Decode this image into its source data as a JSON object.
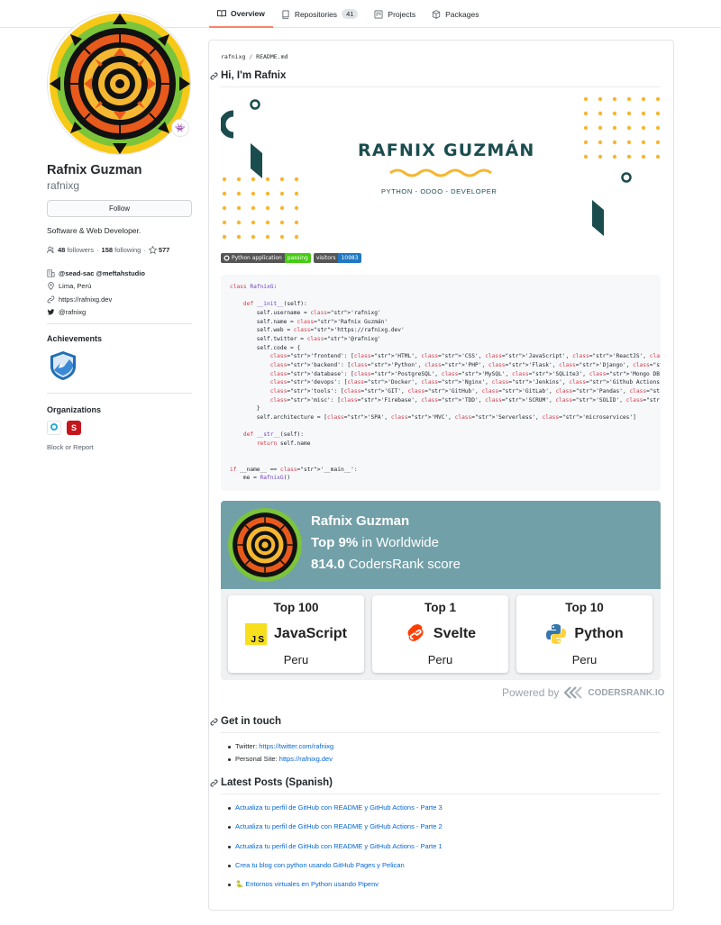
{
  "nav": {
    "tabs": [
      {
        "label": "Overview"
      },
      {
        "label": "Repositories",
        "count": "41"
      },
      {
        "label": "Projects"
      },
      {
        "label": "Packages"
      }
    ]
  },
  "profile": {
    "full_name": "Rafnix Guzman",
    "login": "rafnixg",
    "follow_label": "Follow",
    "bio": "Software & Web Developer.",
    "followers_count": "48",
    "followers_label": "followers",
    "following_count": "158",
    "following_label": "following",
    "stars_count": "577",
    "company": "@sead-sac @meftahstudio",
    "location": "Lima, Perú",
    "website": "https://rafnixg.dev",
    "twitter": "@rafnixg",
    "status_emoji": "👾",
    "achievements_title": "Achievements",
    "organizations_title": "Organizations",
    "orgs": [
      {
        "letter": "T-Gen"
      },
      {
        "letter": "S"
      }
    ],
    "block_label": "Block or Report"
  },
  "readme": {
    "crumb_user": "rafnixg",
    "crumb_file": "README.md",
    "heading": "Hi, I'm Rafnix",
    "banner_name": "RAFNIX GUZMÁN",
    "banner_sub": "PYTHON - ODOO - DEVELOPER",
    "shield1_left": "Python application",
    "shield1_right": "passing",
    "shield2_left": "visitors",
    "shield2_right": "10983",
    "code_lines": [
      "class RafnixG:",
      "",
      "    def __init__(self):",
      "        self.username = 'rafnixg'",
      "        self.name = 'Rafnix Guzmán'",
      "        self.web = 'https://rafnixg.dev'",
      "        self.twitter = '@rafnixg'",
      "        self.code = {",
      "            'frontend': ['HTML', 'CSS', 'JavaScript', 'ReactJS', 'Svelte', 'Boostrap', 'TailWind'],",
      "            'backend': ['Python', 'PHP', 'Flask', 'Django', 'Laravel', 'NodeJS', 'Odoo'],",
      "            'database': ['PostgreSQL', 'MySQL', 'SQLite3', 'Mongo DB'],",
      "            'devops': ['Docker', 'Nginx', 'Jenkins', 'Github Actions', 'AWS', 'Heroku'],",
      "            'tools': ['GIT', 'GitHub', 'GitLab', 'Pandas', 'Jupyter notebook', 'SQLAlchemy', 'Redis', 'Celery'],",
      "            'misc': ['Firebase', 'TDD', 'SCRUM', 'SOLID', 'GNU/Linux']",
      "        }",
      "        self.architecture = ['SPA', 'MVC', 'Serverless', 'microservices']",
      "",
      "    def __str__(self):",
      "        return self.name",
      "",
      "",
      "if __name__ == '__main__':",
      "    me = RafnixG()"
    ],
    "coders": {
      "name": "Rafnix Guzman",
      "rank_bold": "Top 9%",
      "rank_rest": " in Worldwide",
      "score_bold": "814.0",
      "score_rest": " CodersRank score",
      "tiles": [
        {
          "top": "Top 100",
          "lang": "JavaScript",
          "place": "Peru",
          "icon": "javascript-icon"
        },
        {
          "top": "Top 1",
          "lang": "Svelte",
          "place": "Peru",
          "icon": "svelte-icon"
        },
        {
          "top": "Top 10",
          "lang": "Python",
          "place": "Peru",
          "icon": "python-icon"
        }
      ],
      "powered_by": "Powered by",
      "powered_logo": "CODERSRANK.IO"
    },
    "contact_heading": "Get in touch",
    "contact": [
      {
        "label": "Twitter: ",
        "link": "https://twitter.com/rafnixg"
      },
      {
        "label": "Personal Site: ",
        "link": "https://rafnixg.dev"
      }
    ],
    "posts_heading": "Latest Posts (Spanish)",
    "posts": [
      "Actualiza tu perfil de GitHub con README y GitHub Actions - Parte 3",
      "Actualiza tu perfil de GitHub con README y GitHub Actions - Parte 2",
      "Actualiza tu perfil de GitHub con README y GitHub Actions - Parte 1",
      "Crea tu blog con python usando GitHub Pages y Pelican",
      "🐍 Entornos virtuales en Python usando Pipenv"
    ]
  },
  "colors": {
    "accent_tab": "#f9826c",
    "link": "#0366d6",
    "card_teal": "#72a0a8",
    "banner_teal": "#1b4d4f",
    "banner_yellow": "#f5b731"
  }
}
